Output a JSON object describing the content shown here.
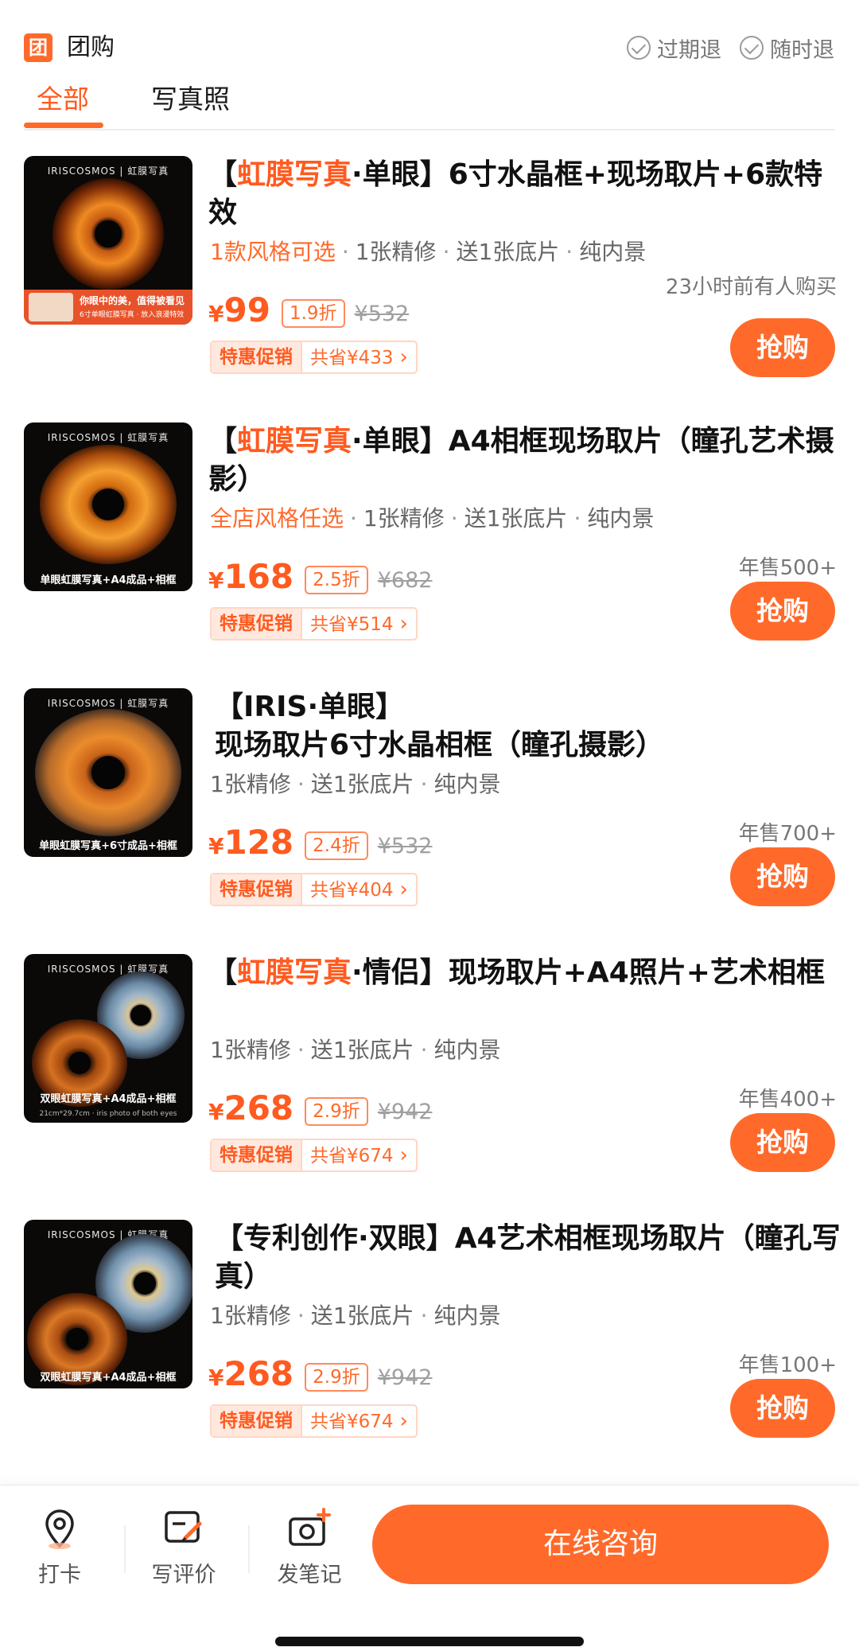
{
  "header": {
    "brand_icon_text": "团",
    "title": "团购",
    "policies": [
      "过期退",
      "随时退"
    ]
  },
  "tabs": [
    {
      "label": "全部",
      "active": true
    },
    {
      "label": "写真照",
      "active": false
    }
  ],
  "products": [
    {
      "title_prefix": "【",
      "title_highlight": "虹膜写真",
      "title_rest": "·单眼】6寸水晶框+现场取片+6款特效",
      "meta_accent": "1款风格可选",
      "meta": [
        "1张精修",
        "送1张底片",
        "纯内景"
      ],
      "price": "99",
      "discount": "1.9折",
      "original_price": "¥532",
      "promo_label": "特惠促销",
      "promo_save": "共省¥433",
      "sales": "23小时前有人购买",
      "buy_label": "抢购",
      "thumb": {
        "brand": "IRISCOSMOS | 虹膜写真",
        "caption_1": "你眼中的美，值得被看见",
        "caption_2": "6寸单眼虹膜写真 · 放入浪漫特效"
      }
    },
    {
      "title_prefix": "【",
      "title_highlight": "虹膜写真",
      "title_rest": "·单眼】A4相框现场取片（瞳孔艺术摄影）",
      "meta_accent": "全店风格任选",
      "meta": [
        "1张精修",
        "送1张底片",
        "纯内景"
      ],
      "price": "168",
      "discount": "2.5折",
      "original_price": "¥682",
      "promo_label": "特惠促销",
      "promo_save": "共省¥514",
      "sales": "年售500+",
      "buy_label": "抢购",
      "thumb": {
        "brand": "IRISCOSMOS | 虹膜写真",
        "caption": "单眼虹膜写真+A4成品+相框"
      }
    },
    {
      "title_prefix": "【IRIS·单眼】",
      "title_highlight": "",
      "title_rest": "现场取片6寸水晶相框（瞳孔摄影）",
      "meta_accent": "",
      "meta": [
        "1张精修",
        "送1张底片",
        "纯内景"
      ],
      "price": "128",
      "discount": "2.4折",
      "original_price": "¥532",
      "promo_label": "特惠促销",
      "promo_save": "共省¥404",
      "sales": "年售700+",
      "buy_label": "抢购",
      "thumb": {
        "brand": "IRISCOSMOS | 虹膜写真",
        "caption": "单眼虹膜写真+6寸成品+相框"
      }
    },
    {
      "title_prefix": "【",
      "title_highlight": "虹膜写真",
      "title_rest": "·情侣】现场取片+A4照片+艺术相框",
      "meta_accent": "",
      "meta": [
        "1张精修",
        "送1张底片",
        "纯内景"
      ],
      "price": "268",
      "discount": "2.9折",
      "original_price": "¥942",
      "promo_label": "特惠促销",
      "promo_save": "共省¥674",
      "sales": "年售400+",
      "buy_label": "抢购",
      "thumb": {
        "brand": "IRISCOSMOS | 虹膜写真",
        "caption": "双眼虹膜写真+A4成品+相框",
        "subcaption": "21cm*29.7cm · iris photo of both eyes"
      }
    },
    {
      "title_prefix": "【专利创作·双眼】",
      "title_highlight": "",
      "title_rest": "A4艺术相框现场取片（瞳孔写真）",
      "meta_accent": "",
      "meta": [
        "1张精修",
        "送1张底片",
        "纯内景"
      ],
      "price": "268",
      "discount": "2.9折",
      "original_price": "¥942",
      "promo_label": "特惠促销",
      "promo_save": "共省¥674",
      "sales": "年售100+",
      "buy_label": "抢购",
      "thumb": {
        "brand": "IRISCOSMOS | 虹膜写真",
        "caption": "双眼虹膜写真+A4成品+相框"
      }
    }
  ],
  "bottom_bar": {
    "checkin": {
      "label": "打卡",
      "icon": "location-pin-icon"
    },
    "review": {
      "label": "写评价",
      "icon": "edit-review-icon"
    },
    "note": {
      "label": "发笔记",
      "icon": "camera-plus-icon"
    },
    "consult_label": "在线咨询"
  },
  "colors": {
    "accent": "#ff6a2b",
    "price": "#ff5a1f",
    "text": "#111111",
    "muted": "#777777"
  }
}
